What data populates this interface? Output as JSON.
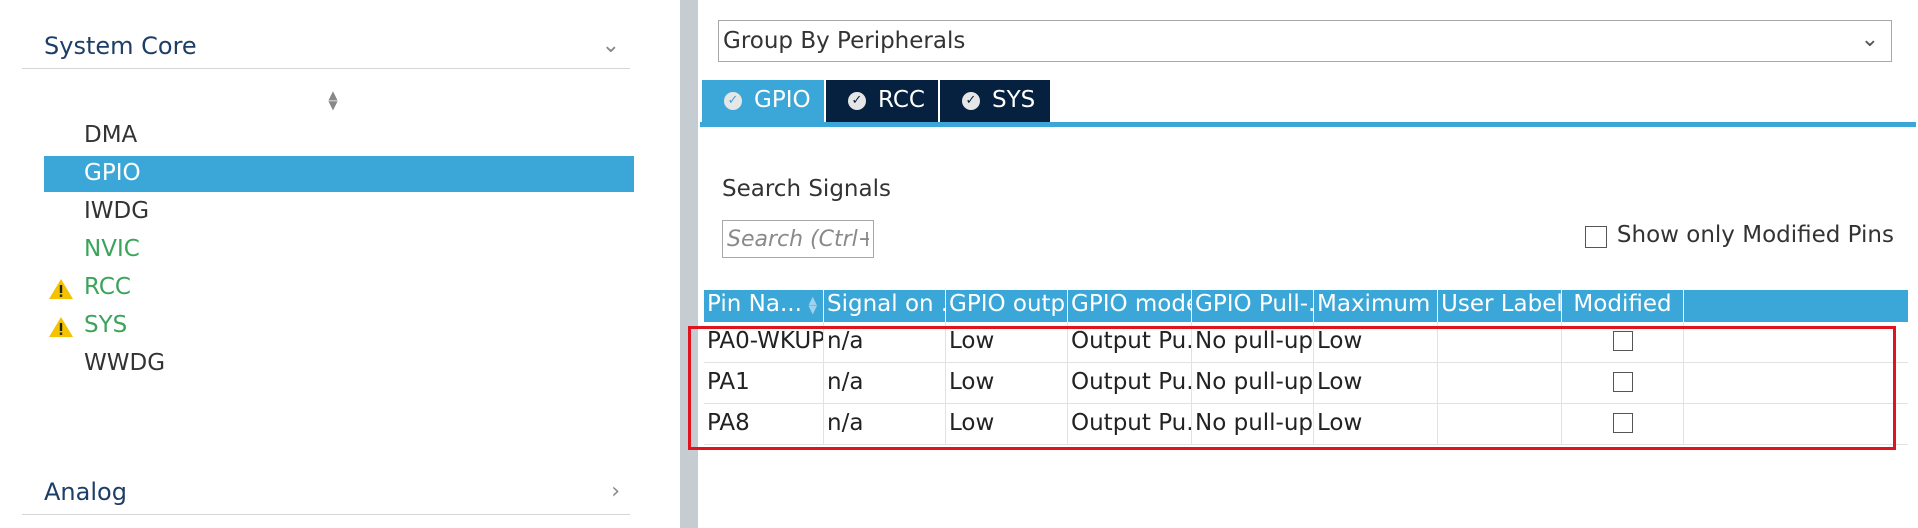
{
  "left_panel": {
    "system_core": "System Core",
    "analog": "Analog",
    "items": [
      {
        "label": "DMA",
        "state": "normal",
        "warning": false
      },
      {
        "label": "GPIO",
        "state": "selected",
        "warning": false
      },
      {
        "label": "IWDG",
        "state": "normal",
        "warning": false
      },
      {
        "label": "NVIC",
        "state": "enabled",
        "warning": false
      },
      {
        "label": "RCC",
        "state": "enabled",
        "warning": true
      },
      {
        "label": "SYS",
        "state": "enabled",
        "warning": true
      },
      {
        "label": "WWDG",
        "state": "normal",
        "warning": false
      }
    ]
  },
  "right_panel": {
    "group_by": "Group By Peripherals",
    "tabs": [
      {
        "label": "GPIO",
        "active": true
      },
      {
        "label": "RCC",
        "active": false
      },
      {
        "label": "SYS",
        "active": false
      }
    ],
    "search_label": "Search Signals",
    "search_placeholder": "Search (Ctrl+F)",
    "show_modified_label": "Show only Modified Pins",
    "table": {
      "headers": [
        "Pin Na...",
        "Signal on ...",
        "GPIO outp...",
        "GPIO mode",
        "GPIO Pull-...",
        "Maximum ...",
        "User Label",
        "Modified"
      ],
      "rows": [
        [
          "PA0-WKUP",
          "n/a",
          "Low",
          "Output Pu...",
          "No pull-up...",
          "Low",
          "",
          false
        ],
        [
          "PA1",
          "n/a",
          "Low",
          "Output Pu...",
          "No pull-up...",
          "Low",
          "",
          false
        ],
        [
          "PA8",
          "n/a",
          "Low",
          "Output Pu...",
          "No pull-up...",
          "Low",
          "",
          false
        ]
      ]
    }
  },
  "colors": {
    "accent": "#3aa7d8",
    "tab_dark": "#05213f",
    "enabled_green": "#3aa45b",
    "warning_yellow": "#f3c300",
    "highlight_red": "#e0141e"
  },
  "icons": {
    "category_open": "chevron-down-icon",
    "category_closed": "chevron-right-icon",
    "warning": "warning-icon",
    "tab_check": "check-circle-icon",
    "sort": "sort-arrows-icon",
    "dropdown": "chevron-down-icon"
  }
}
